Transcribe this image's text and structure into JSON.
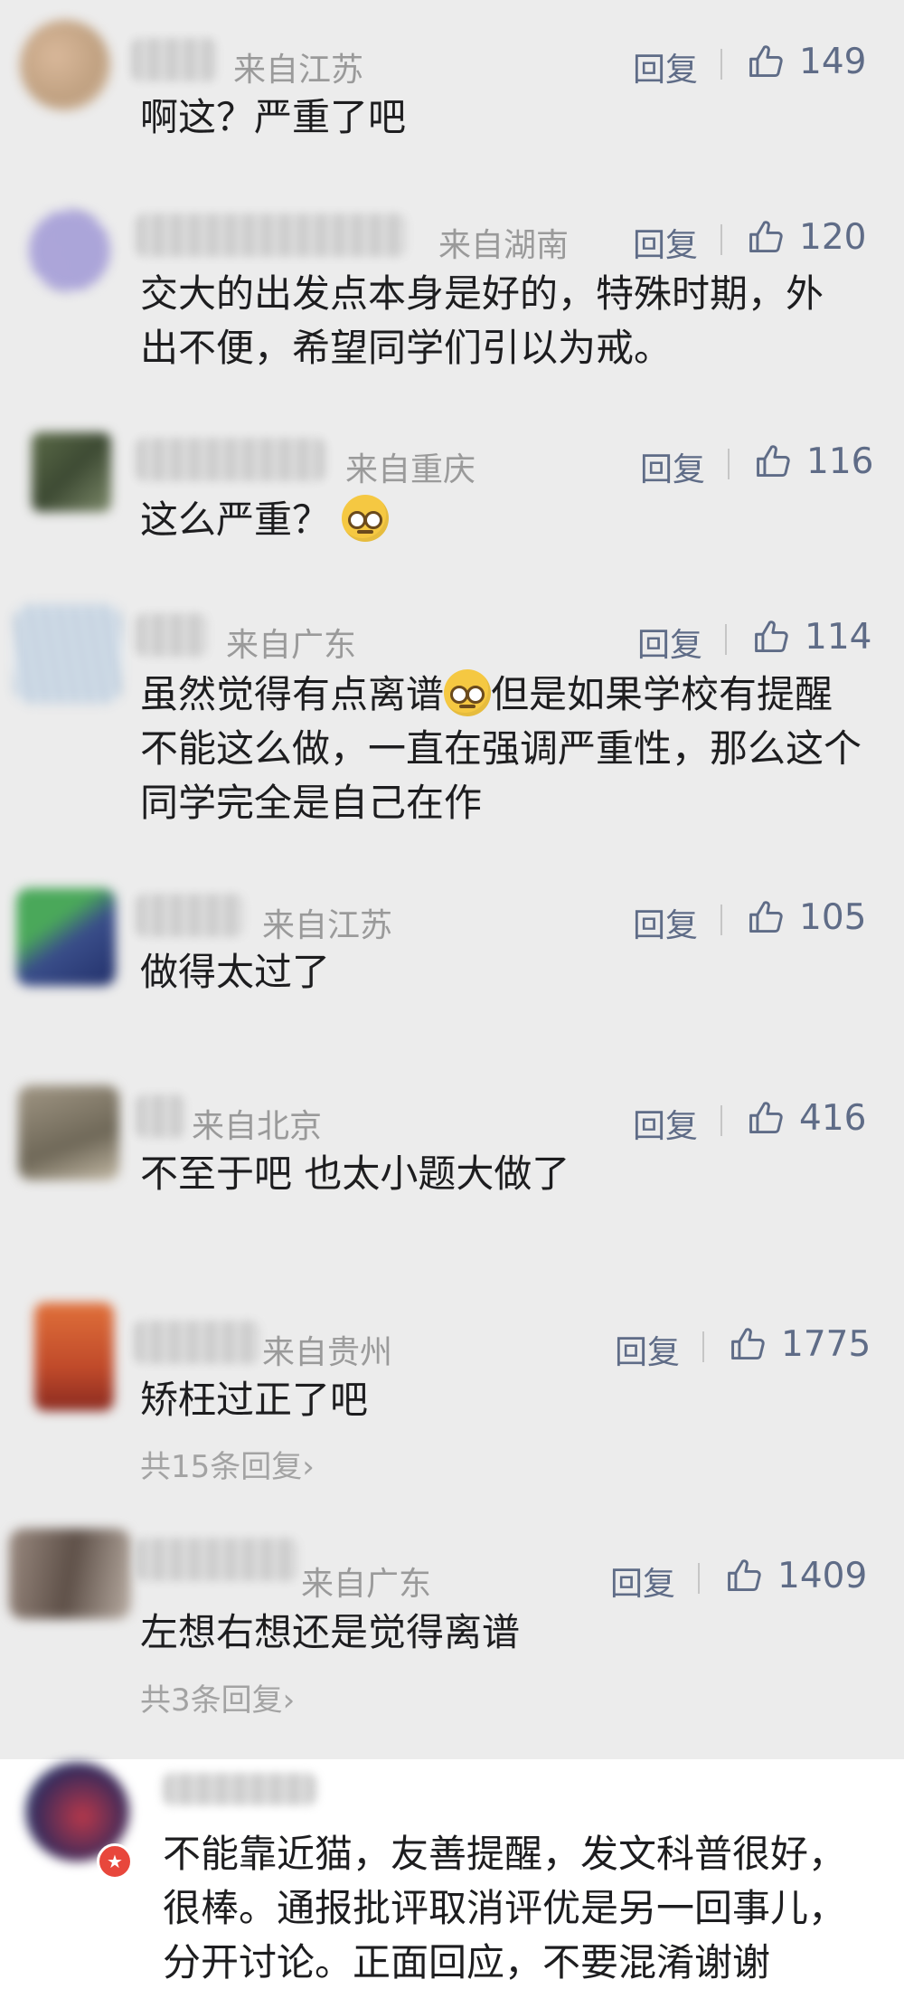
{
  "comments": [
    {
      "location": "来自江苏",
      "reply": "回复",
      "likes": "149",
      "text": "啊这？严重了吧"
    },
    {
      "location": "来自湖南",
      "reply": "回复",
      "likes": "120",
      "text": "交大的出发点本身是好的，特殊时期，外出不便，希望同学们引以为戒。"
    },
    {
      "location": "来自重庆",
      "reply": "回复",
      "likes": "116",
      "text": "这么严重？"
    },
    {
      "location": "来自广东",
      "reply": "回复",
      "likes": "114",
      "text_a": "虽然觉得有点离谱",
      "text_b": "但是如果学校有提醒不能这么做，一直在强调严重性，那么这个同学完全是自己在作"
    },
    {
      "location": "来自江苏",
      "reply": "回复",
      "likes": "105",
      "text": "做得太过了"
    },
    {
      "location": "来自北京",
      "reply": "回复",
      "likes": "416",
      "text": "不至于吧 也太小题大做了"
    },
    {
      "location": "来自贵州",
      "reply": "回复",
      "likes": "1775",
      "text": "矫枉过正了吧",
      "sub": "共15条回复›"
    },
    {
      "location": "来自广东",
      "reply": "回复",
      "likes": "1409",
      "text": "左想右想还是觉得离谱",
      "sub": "共3条回复›"
    },
    {
      "text": "不能靠近猫，友善提醒，发文科普很好，很棒。通报批评取消评优是另一回事儿，分开讨论。正面回应，不要混淆谢谢"
    }
  ],
  "icons": {
    "like": "thumbs-up-icon",
    "emoji": "pleading-face-icon",
    "badge": "verified-badge-icon"
  },
  "colors": {
    "accent": "#5f6c87",
    "meta": "#9a9a9a",
    "background": "#ececec"
  }
}
